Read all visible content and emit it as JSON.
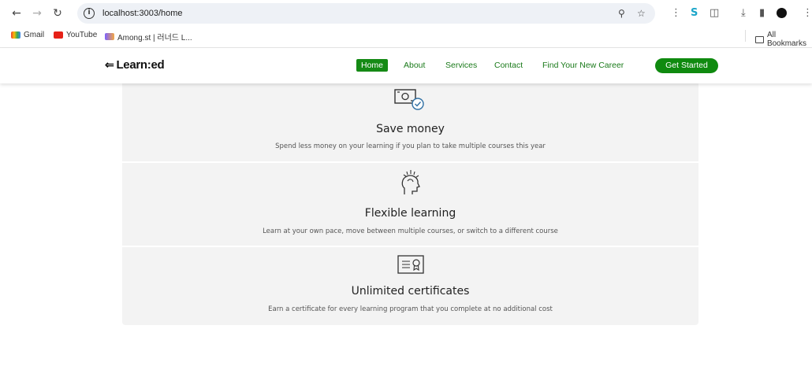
{
  "browser": {
    "url": "localhost:3003/home",
    "bookmarks": [
      {
        "label": "Gmail"
      },
      {
        "label": "YouTube"
      },
      {
        "label": "Among.st | 러너드 L..."
      }
    ],
    "all_bookmarks_label": "All Bookmarks"
  },
  "site": {
    "logo": "Learn:ed",
    "nav": [
      {
        "label": "Home",
        "active": true
      },
      {
        "label": "About"
      },
      {
        "label": "Services"
      },
      {
        "label": "Contact"
      },
      {
        "label": "Find Your New Career"
      }
    ],
    "cta_label": "Get Started"
  },
  "features": [
    {
      "icon": "money-check-icon",
      "title": "Save money",
      "description": "Spend less money on your learning if you plan to take multiple courses this year"
    },
    {
      "icon": "head-idea-icon",
      "title": "Flexible learning",
      "description": "Learn at your own pace, move between multiple courses, or switch to a different course"
    },
    {
      "icon": "certificate-icon",
      "title": "Unlimited certificates",
      "description": "Earn a certificate for every learning program that you complete at no additional cost"
    }
  ],
  "colors": {
    "brand_green": "#158a15",
    "card_bg": "#f3f3f3"
  }
}
